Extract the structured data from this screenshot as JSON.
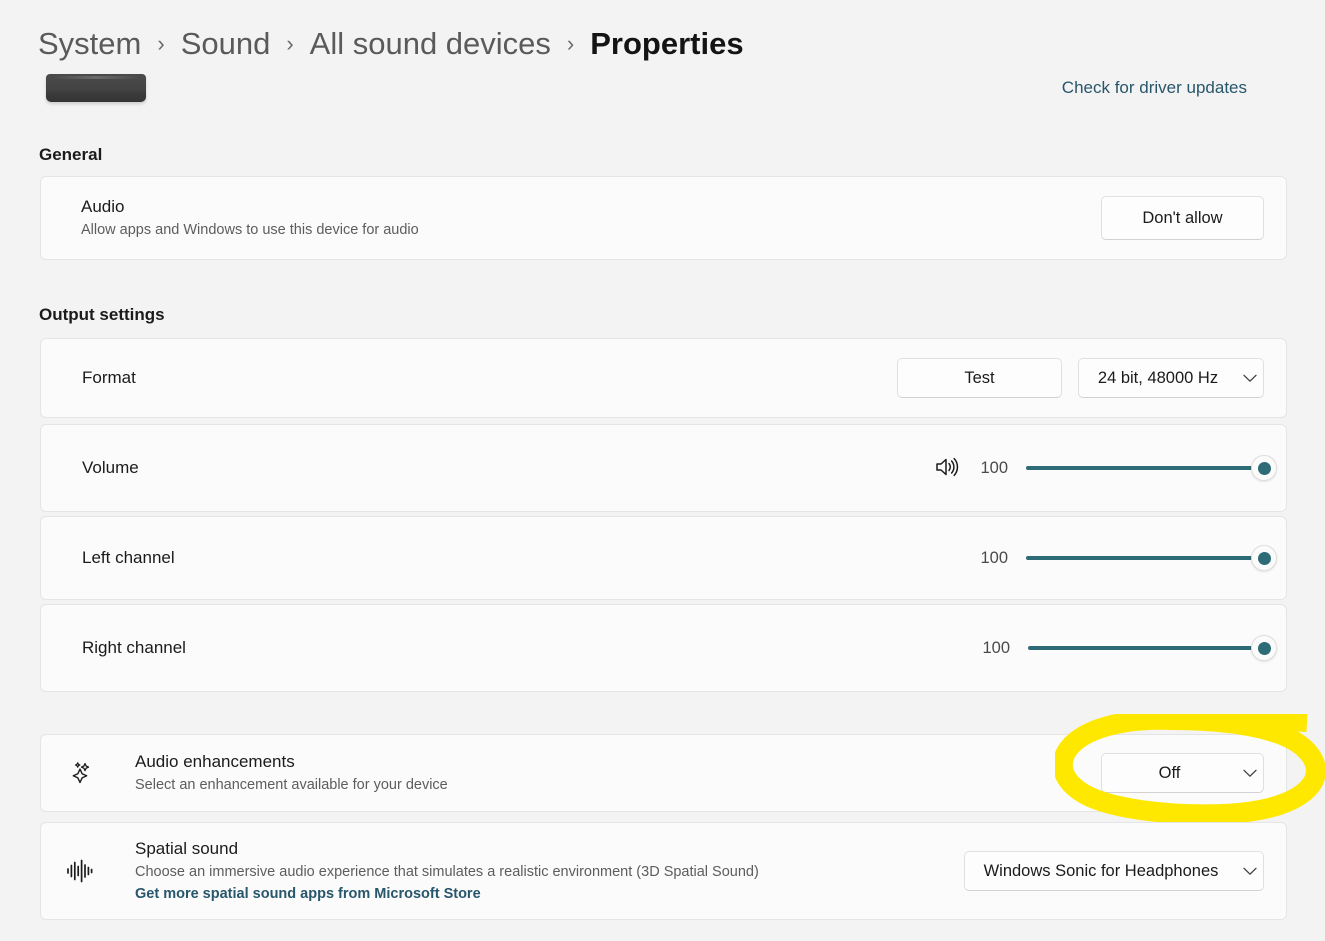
{
  "breadcrumb": {
    "items": [
      {
        "label": "System",
        "current": false
      },
      {
        "label": "Sound",
        "current": false
      },
      {
        "label": "All sound devices",
        "current": false
      },
      {
        "label": "Properties",
        "current": true
      }
    ],
    "separator": "›"
  },
  "header": {
    "driver_link": "Check for driver updates",
    "device_image_name": "audio-device-thumbnail"
  },
  "sections": {
    "general": {
      "title": "General",
      "audio": {
        "title": "Audio",
        "subtitle": "Allow apps and Windows to use this device for audio",
        "button_label": "Don't allow"
      }
    },
    "output_settings": {
      "title": "Output settings",
      "format": {
        "label": "Format",
        "test_button": "Test",
        "selected": "24 bit, 48000 Hz"
      },
      "volume": {
        "label": "Volume",
        "value": "100",
        "percent": 100,
        "icon": "speaker-icon"
      },
      "left_channel": {
        "label": "Left channel",
        "value": "100",
        "percent": 100
      },
      "right_channel": {
        "label": "Right channel",
        "value": "100",
        "percent": 100
      }
    },
    "enhancements": {
      "title": "Audio enhancements",
      "subtitle": "Select an enhancement available for your device",
      "selected": "Off",
      "icon": "sparkle-icon"
    },
    "spatial": {
      "title": "Spatial sound",
      "subtitle": "Choose an immersive audio experience that simulates a realistic environment (3D Spatial Sound)",
      "link": "Get more spatial sound apps from Microsoft Store",
      "selected": "Windows Sonic for Headphones",
      "icon": "waveform-icon"
    }
  },
  "annotation": {
    "type": "highlighter-ellipse",
    "target": "audio-enhancements-dropdown",
    "color": "#ffe800"
  },
  "colors": {
    "page_background": "#f3f3f3",
    "card_background": "#fbfbfb",
    "accent_slider": "#2d6b76",
    "link": "#28566b",
    "highlight": "#ffe800"
  }
}
